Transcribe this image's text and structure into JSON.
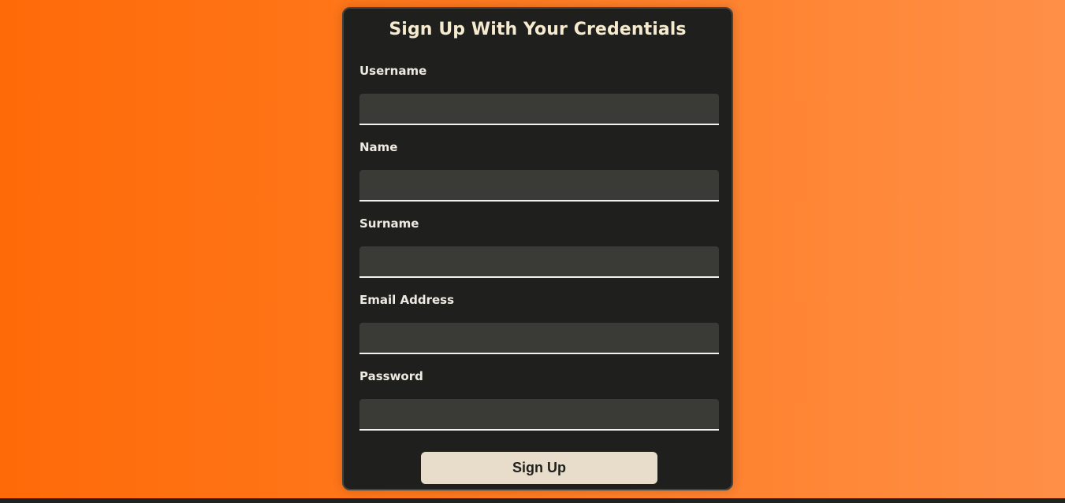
{
  "form": {
    "title": "Sign Up With Your Credentials",
    "fields": [
      {
        "label": "Username",
        "value": "",
        "placeholder": ""
      },
      {
        "label": "Name",
        "value": "",
        "placeholder": ""
      },
      {
        "label": "Surname",
        "value": "",
        "placeholder": ""
      },
      {
        "label": "Email Address",
        "value": "",
        "placeholder": ""
      },
      {
        "label": "Password",
        "value": "",
        "placeholder": ""
      }
    ],
    "submit_label": "Sign Up"
  },
  "colors": {
    "background_gradient_start": "#ff6a08",
    "background_gradient_end": "#ff8f47",
    "card_background": "#1f201e",
    "input_background": "#3a3b37",
    "title_text": "#f6ebcf",
    "button_background": "#e8dcca"
  }
}
